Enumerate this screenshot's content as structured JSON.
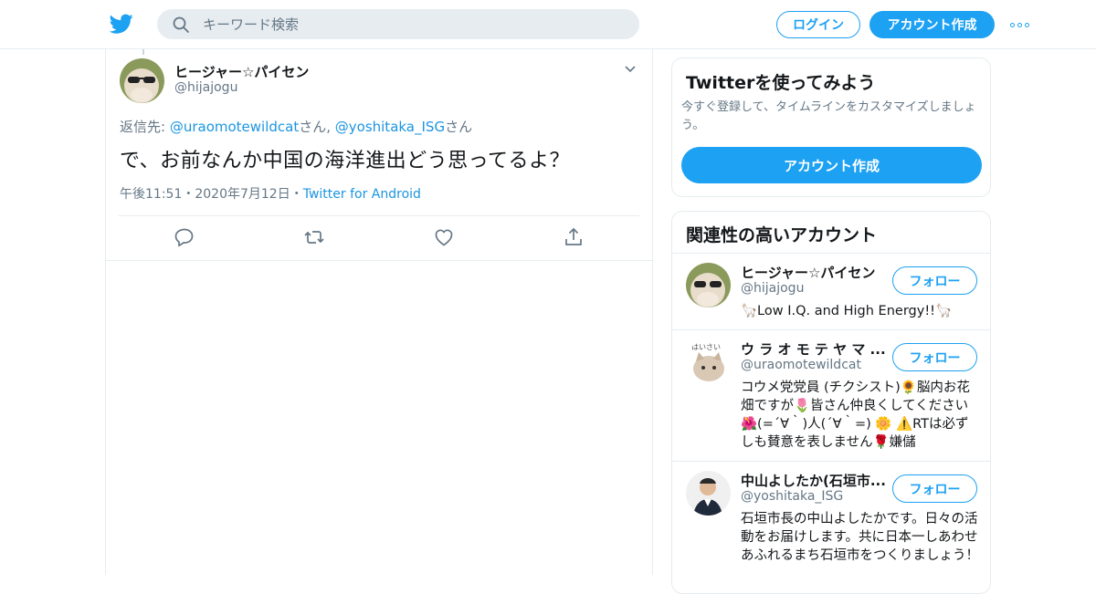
{
  "header": {
    "search_placeholder": "キーワード検索",
    "login_label": "ログイン",
    "signup_label": "アカウント作成",
    "brand_color": "#1da1f2"
  },
  "tweet": {
    "author_name": "ヒージャー☆パイセン",
    "author_handle": "@hijajogu",
    "reply_prefix": "返信先: ",
    "reply_user1": "@uraomotewildcat",
    "reply_sep": "さん, ",
    "reply_user2": "@yoshitaka_ISG",
    "reply_suffix": "さん",
    "text": "で、お前なんか中国の海洋進出どう思ってるよ？",
    "time": "午後11:51",
    "date": "2020年7月12日",
    "dot": "・",
    "source": "Twitter for Android",
    "actions": [
      "reply-icon",
      "retweet-icon",
      "like-icon",
      "share-icon"
    ]
  },
  "signup_card": {
    "title": "Twitterを使ってみよう",
    "description": "今すぐ登録して、タイムラインをカスタマイズしましょう。",
    "button_label": "アカウント作成"
  },
  "related": {
    "title": "関連性の高いアカウント",
    "follow_label": "フォロー",
    "accounts": [
      {
        "name": "ヒージャー☆パイセン",
        "handle": "@hijajogu",
        "bio": "🦙Low I.Q. and High Energy!!🦙"
      },
      {
        "name": "ウ ラ オ モ テ ヤ マ ...",
        "handle": "@uraomotewildcat",
        "bio": "コウメ党党員 (チクシスト)🌻脳内お花畑ですが🌷皆さん仲良くしてください🌺(=´∀｀)人(´∀｀=) 🌼 ⚠️RTは必ずしも賛意を表しません🌹嫌儲"
      },
      {
        "name": "中山よしたか(石垣市...",
        "handle": "@yoshitaka_ISG",
        "bio": "石垣市長の中山よしたかです。日々の活動をお届けします。共に日本一しあわせあふれるまち石垣市をつくりましょう！"
      }
    ]
  }
}
